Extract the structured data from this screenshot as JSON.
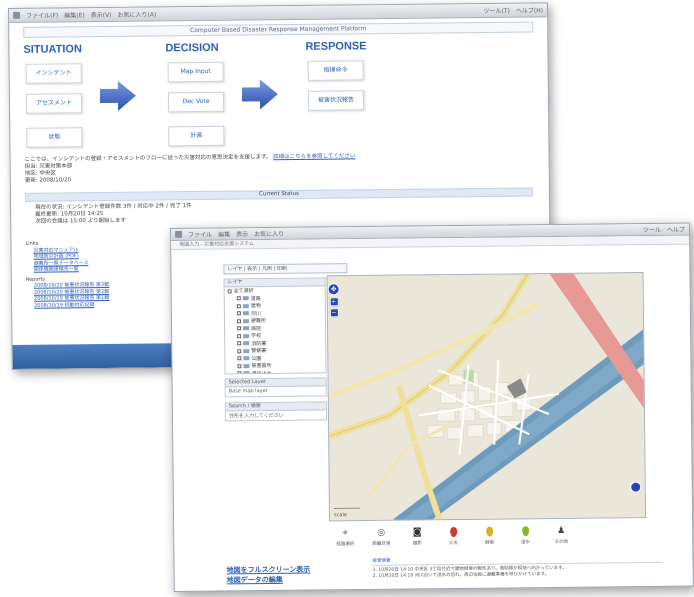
{
  "back_window": {
    "titlebar_items": [
      "ファイル(F)",
      "編集(E)",
      "表示(V)",
      "お気に入り(A)",
      "ツール(T)",
      "ヘルプ(H)"
    ],
    "platform_title": "Computer Based Disaster Response Management Platform",
    "columns": [
      {
        "heading": "SITUATION",
        "buttons": [
          "インシデント",
          "アセスメント",
          "状態"
        ]
      },
      {
        "heading": "DECISION",
        "buttons": [
          "Map Input",
          "Dec Vote",
          "計画"
        ]
      },
      {
        "heading": "RESPONSE",
        "buttons": [
          "指揮命令",
          "被害状況報告"
        ]
      }
    ],
    "notes": [
      "ここでは、インシデントの登録・アセスメントのフローに従った災害対応の意思決定を支援します。",
      "担当: 災害対策本部",
      "地区: 中央区",
      "更新: 2008/10/20"
    ],
    "note_link": "詳細はこちらを参照してください",
    "status_text": "Current Status",
    "status_lines": [
      "現在の状況: インシデント登録件数 3件 / 対応中 2件 / 完了 1件",
      "最終更新: 10月20日 14:25",
      "次回の会議は 15:00 より開始します"
    ],
    "list_head": "Links",
    "list_items": [
      "災害対応マニュアル",
      "地域防災計画 (PDF)",
      "避難所一覧データベース",
      "関係機関連絡先一覧"
    ],
    "list_head2": "Reports",
    "list_items2": [
      "2008/10/20 被害状況報告 第3報",
      "2008/10/20 被害状況報告 第2報",
      "2008/10/19 被害状況報告 第1報",
      "2008/10/19 初動対応記録"
    ]
  },
  "front_window": {
    "titlebar_items": [
      "ファイル",
      "編集",
      "表示",
      "お気に入り",
      "ツール",
      "ヘルプ"
    ],
    "subbar_text": "地図入力 - 災害対応支援システム",
    "map_toolbar": "レイヤ | 表示 | 凡例 | 印刷",
    "tree_head": "レイヤ",
    "tree_items": [
      "全て選択",
      "道路",
      "建物",
      "河川",
      "避難所",
      "病院",
      "学校",
      "消防署",
      "警察署",
      "公園",
      "被害箇所",
      "通行止め"
    ],
    "panel2_head": "Selected Layer",
    "panel2_body": "Base map layer",
    "panel3_head": "Search / 検索",
    "panel3_body": "住所を入力してください",
    "markers": [
      {
        "label": "経路選択",
        "icon": "route-icon",
        "color": "#555555"
      },
      {
        "label": "距離計測",
        "icon": "measure-icon",
        "color": "#555555"
      },
      {
        "label": "撮影",
        "icon": "camera-icon",
        "color": "#333333"
      },
      {
        "label": "火災",
        "icon": "pin-red-icon",
        "color": "#d23b2b"
      },
      {
        "label": "倒壊",
        "icon": "pin-yellow-icon",
        "color": "#d6b41e"
      },
      {
        "label": "浸水",
        "icon": "pin-green-icon",
        "color": "#8bb52a"
      },
      {
        "label": "その他",
        "icon": "person-icon",
        "color": "#444444"
      }
    ],
    "links": [
      "地図をフルスクリーン表示",
      "地図データの編集"
    ],
    "info_head": "被害情報",
    "info_lines": [
      "1. 10月20日 14:10 中央区 3丁目付近で建物倒壊の報告あり。救助隊が現地へ向かっています。",
      "2. 10月20日 14:18 河川沿いで浸水の恐れ。周辺住民に避難準備を呼びかけています。"
    ]
  },
  "colors": {
    "accent": "#2f5fb8",
    "footer": "#3d6fb0",
    "river": "#5b8fb2",
    "road": "#efe09a"
  }
}
